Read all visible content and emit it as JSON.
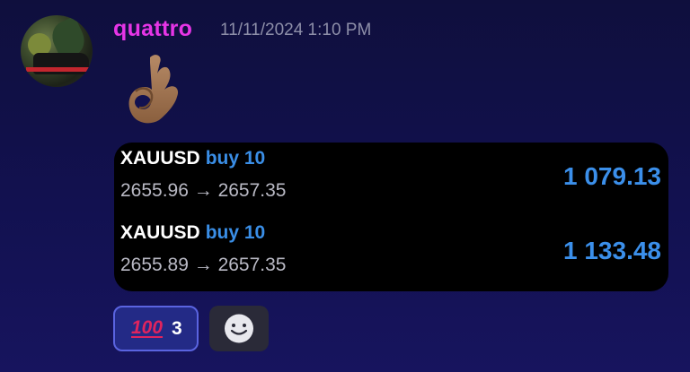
{
  "message": {
    "username": "quattro",
    "timestamp": "11/11/2024 1:10 PM",
    "emoji": "ok-hand-emoji"
  },
  "trades": [
    {
      "symbol": "XAUUSD",
      "side": "buy 10",
      "prices": "2655.96 → 2657.35",
      "profit": "1 079.13"
    },
    {
      "symbol": "XAUUSD",
      "side": "buy 10",
      "prices": "2655.89 → 2657.35",
      "profit": "1 133.48"
    }
  ],
  "reactions": [
    {
      "emoji": "100",
      "count": "3"
    }
  ],
  "add_reaction": {
    "icon": "smiley-icon"
  },
  "colors": {
    "username": "#e635e6",
    "accent_blue": "#3a8ee6",
    "card_bg": "#000000",
    "reaction_bg": "#232a86",
    "reaction_border": "#5a64e0"
  }
}
